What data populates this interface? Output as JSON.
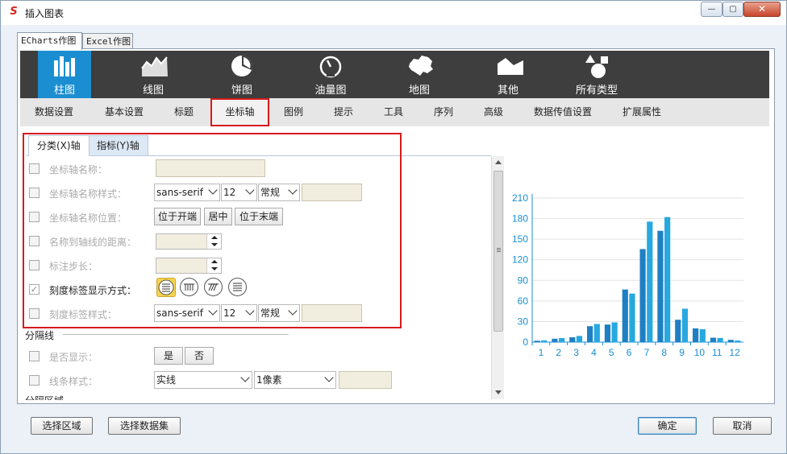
{
  "window": {
    "title": "插入图表",
    "app_icon": "S",
    "minimize": "—",
    "maximize": "▢",
    "close": "✕"
  },
  "outer_tabs": [
    {
      "label": "ECharts作图"
    },
    {
      "label": "Excel作图"
    }
  ],
  "chart_types": [
    {
      "label": "柱图",
      "icon": "bar-chart-icon"
    },
    {
      "label": "线图",
      "icon": "line-chart-icon"
    },
    {
      "label": "饼图",
      "icon": "pie-chart-icon"
    },
    {
      "label": "油量图",
      "icon": "gauge-icon"
    },
    {
      "label": "地图",
      "icon": "map-icon"
    },
    {
      "label": "其他",
      "icon": "area-shape-icon"
    },
    {
      "label": "所有类型",
      "icon": "shapes-icon"
    }
  ],
  "sub_tabs": [
    "数据设置",
    "基本设置",
    "标题",
    "坐标轴",
    "图例",
    "提示",
    "工具",
    "序列",
    "高级",
    "数据传值设置",
    "扩展属性"
  ],
  "inner_tabs": [
    "分类(X)轴",
    "指标(Y)轴"
  ],
  "rows": {
    "axis_name": "坐标轴名称：",
    "axis_name_style": "坐标轴名称样式：",
    "axis_name_position": "坐标轴名称位置：",
    "name_distance": "名称到轴线的距离：",
    "label_step": "标注步长：",
    "tick_label_mode": "刻度标签显示方式：",
    "tick_label_style": "刻度标签样式："
  },
  "font_style_1": {
    "family": "sans-serif",
    "size": "12",
    "weight": "常规"
  },
  "font_style_2": {
    "family": "sans-serif",
    "size": "12",
    "weight": "常规"
  },
  "position_buttons": [
    "位于开端",
    "居中",
    "位于末端"
  ],
  "split_line": {
    "section": "分隔线",
    "show_label": "是否显示：",
    "yes": "是",
    "no": "否",
    "style_label": "线条样式：",
    "line_type": "实线",
    "line_width": "1像素"
  },
  "cut_section": "分隔区域",
  "bottom": {
    "select_area": "选择区域",
    "select_dataset": "选择数据集",
    "ok": "确定",
    "cancel": "取消"
  },
  "colors": {
    "accent": "#1b8ed1",
    "bar_dark": "#1f7fc4",
    "bar_light": "#27a8e0",
    "highlight": "#d61b1b"
  },
  "chart_data": {
    "type": "bar",
    "categories": [
      "1",
      "2",
      "3",
      "4",
      "5",
      "6",
      "7",
      "8",
      "9",
      "10",
      "11",
      "12"
    ],
    "series": [
      {
        "values": [
          2.6,
          5.9,
          9.0,
          26.4,
          28.7,
          70.7,
          175.6,
          182.2,
          48.7,
          18.8,
          6.0,
          2.3
        ]
      },
      {
        "values": [
          2.0,
          4.9,
          7.0,
          23.2,
          25.6,
          76.7,
          135.6,
          162.2,
          32.6,
          20.0,
          6.4,
          3.3
        ]
      }
    ],
    "yticks": [
      0,
      30,
      60,
      90,
      120,
      150,
      180,
      210
    ],
    "ylim": [
      0,
      210
    ],
    "grid": true
  }
}
